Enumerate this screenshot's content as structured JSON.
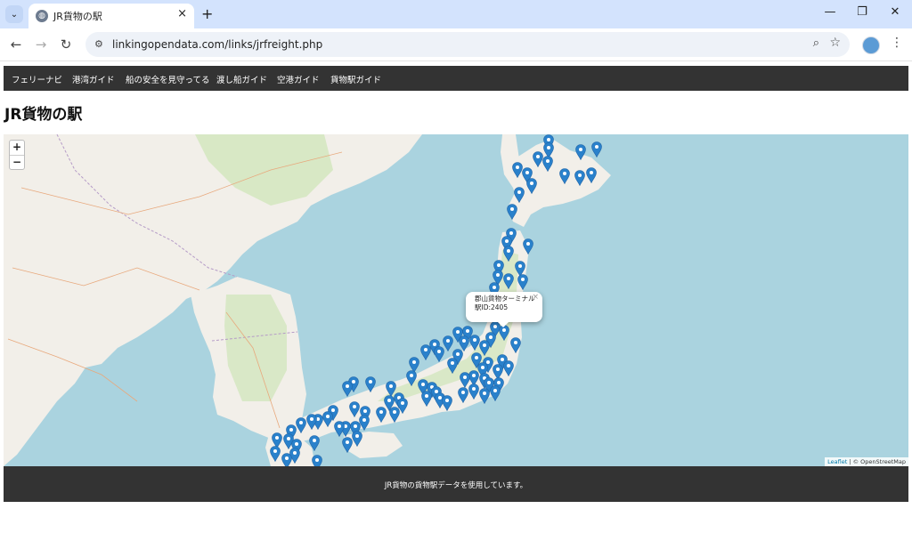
{
  "browser": {
    "tab_title": "JR貨物の駅",
    "url": "linkingopendata.com/links/jrfreight.php"
  },
  "nav": {
    "items": [
      "フェリーナビ",
      "港湾ガイド",
      "船の安全を見守ってる",
      "渡し船ガイド",
      "空港ガイド",
      "貨物駅ガイド"
    ]
  },
  "page": {
    "title": "JR貨物の駅"
  },
  "map": {
    "zoom_in": "+",
    "zoom_out": "−",
    "popup": {
      "name": "郡山貨物ターミナル",
      "station_id": "駅ID:2405",
      "close": "×"
    },
    "attribution_leaflet": "Leaflet",
    "attribution_osm": "| © OpenStreetMap",
    "colors": {
      "sea": "#aad3df",
      "land": "#f2efe9",
      "marker": "#2a81cb"
    }
  },
  "footer": {
    "text": "JR貨物の貨物駅データを使用しています。"
  }
}
